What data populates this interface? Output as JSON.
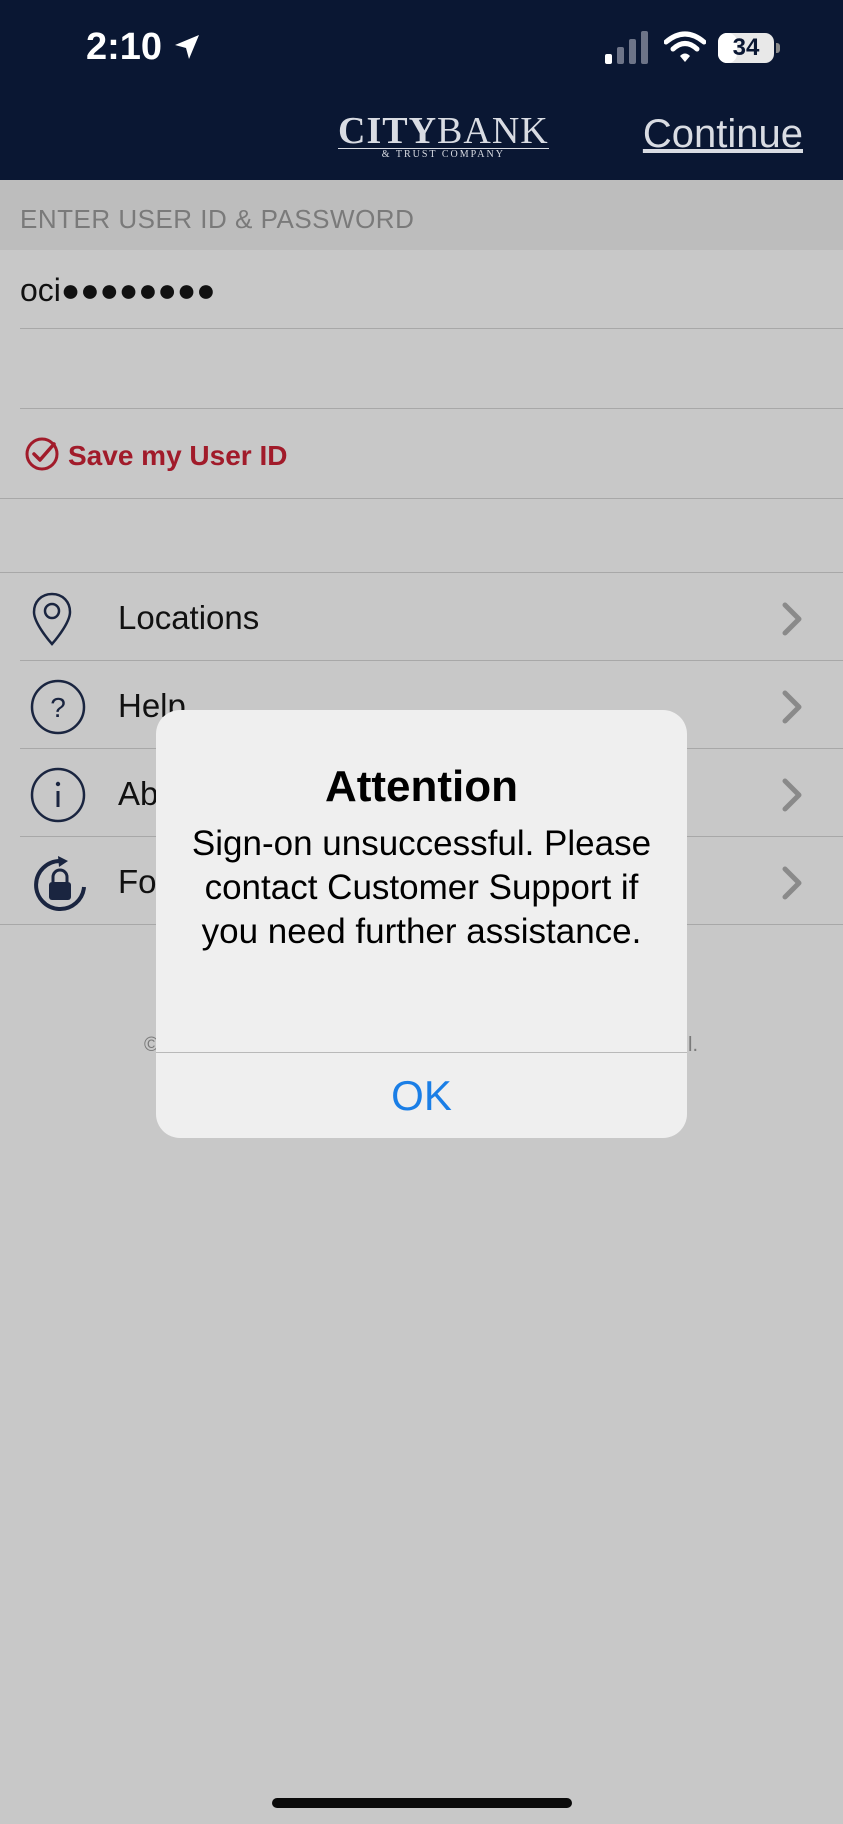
{
  "status_bar": {
    "time": "2:10",
    "battery": "34"
  },
  "nav": {
    "logo_text_city": "CITY",
    "logo_text_bank": "BANK",
    "logo_subtitle": "& TRUST COMPANY",
    "continue_label": "Continue"
  },
  "form": {
    "section_header": "ENTER USER ID & PASSWORD",
    "user_id_value": "oci●●●●●●●●",
    "password_value": "",
    "save_user_id_label": "Save my User ID"
  },
  "menu": {
    "items": [
      {
        "label": "Locations",
        "icon": "location-pin-icon"
      },
      {
        "label": "Help",
        "icon": "question-circle-icon"
      },
      {
        "label": "Ab",
        "icon": "info-circle-icon"
      },
      {
        "label": "Fo",
        "icon": "lock-refresh-icon"
      }
    ]
  },
  "footer": {
    "left_fragment": "©",
    "right_fragment": "l."
  },
  "alert": {
    "title": "Attention",
    "message": "Sign-on unsuccessful. Please contact Customer Support if you need further assistance.",
    "ok_label": "OK"
  },
  "colors": {
    "nav_bg": "#0a1733",
    "accent_red": "#a11b2a",
    "link_blue": "#1a7ee6",
    "dim_bg": "#c8c8c8"
  }
}
